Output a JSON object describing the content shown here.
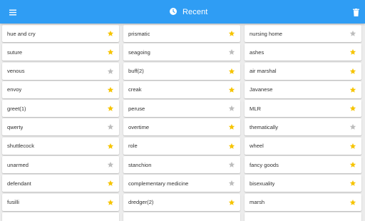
{
  "header": {
    "title": "Recent",
    "menu_icon": "menu-icon",
    "title_icon": "clock-icon",
    "action_icon": "trash-icon",
    "bar_color": "#2f9df4"
  },
  "colors": {
    "star_on": "#f6c400",
    "star_off": "#bdbdbd"
  },
  "columns": [
    {
      "items": [
        {
          "word": "hue and cry",
          "starred": true
        },
        {
          "word": "suture",
          "starred": true
        },
        {
          "word": "venous",
          "starred": false
        },
        {
          "word": "envoy",
          "starred": true
        },
        {
          "word": "greet(1)",
          "starred": true
        },
        {
          "word": "qwerty",
          "starred": false
        },
        {
          "word": "shuttlecock",
          "starred": true
        },
        {
          "word": "unarmed",
          "starred": false
        },
        {
          "word": "defendant",
          "starred": true
        },
        {
          "word": "fusilli",
          "starred": true
        },
        {
          "word": "",
          "starred": false
        }
      ]
    },
    {
      "items": [
        {
          "word": "prismatic",
          "starred": true
        },
        {
          "word": "seagoing",
          "starred": false
        },
        {
          "word": "buff(2)",
          "starred": true
        },
        {
          "word": "creak",
          "starred": true
        },
        {
          "word": "peruse",
          "starred": false
        },
        {
          "word": "overtime",
          "starred": true
        },
        {
          "word": "role",
          "starred": true
        },
        {
          "word": "stanchion",
          "starred": false
        },
        {
          "word": "complementary medicine",
          "starred": false
        },
        {
          "word": "dredger(2)",
          "starred": true
        },
        {
          "word": "",
          "starred": false
        }
      ]
    },
    {
      "items": [
        {
          "word": "nursing home",
          "starred": false
        },
        {
          "word": "ashes",
          "starred": true
        },
        {
          "word": "air marshal",
          "starred": true
        },
        {
          "word": "Javanese",
          "starred": true
        },
        {
          "word": "MLR",
          "starred": true
        },
        {
          "word": "thematically",
          "starred": false
        },
        {
          "word": "wheel",
          "starred": true
        },
        {
          "word": "fancy goods",
          "starred": true
        },
        {
          "word": "bisexuality",
          "starred": true
        },
        {
          "word": "marsh",
          "starred": true
        },
        {
          "word": "",
          "starred": false
        }
      ]
    }
  ]
}
